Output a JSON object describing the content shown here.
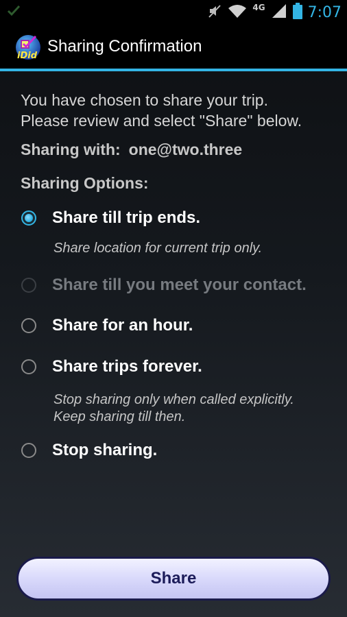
{
  "status_bar": {
    "time": "7:07",
    "network": "4G",
    "icons": [
      "check-icon",
      "mute-icon",
      "wifi-icon",
      "signal-icon",
      "battery-icon"
    ]
  },
  "action_bar": {
    "title": "Sharing Confirmation",
    "logo_text": "iDid"
  },
  "content": {
    "intro_line1": "You have chosen to share your trip.",
    "intro_line2": "Please review and select \"Share\" below.",
    "sharing_with_label": "Sharing with:",
    "sharing_with_email": "one@two.three",
    "options_label": "Sharing Options:",
    "options": [
      {
        "label": "Share till trip ends.",
        "selected": true,
        "enabled": true
      },
      {
        "label": "Share till you meet your contact.",
        "selected": false,
        "enabled": false
      },
      {
        "label": "Share for an hour.",
        "selected": false,
        "enabled": true
      },
      {
        "label": "Share trips forever.",
        "selected": false,
        "enabled": true
      },
      {
        "label": "Stop sharing.",
        "selected": false,
        "enabled": true
      }
    ],
    "desc_trip_ends": "Share location for current trip only.",
    "desc_forever_line1": "Stop sharing only when called explicitly.",
    "desc_forever_line2": "Keep sharing till then."
  },
  "share_button_label": "Share",
  "colors": {
    "accent": "#33b5e5",
    "button_text": "#1c1c5a",
    "disabled_text": "#777b80"
  }
}
